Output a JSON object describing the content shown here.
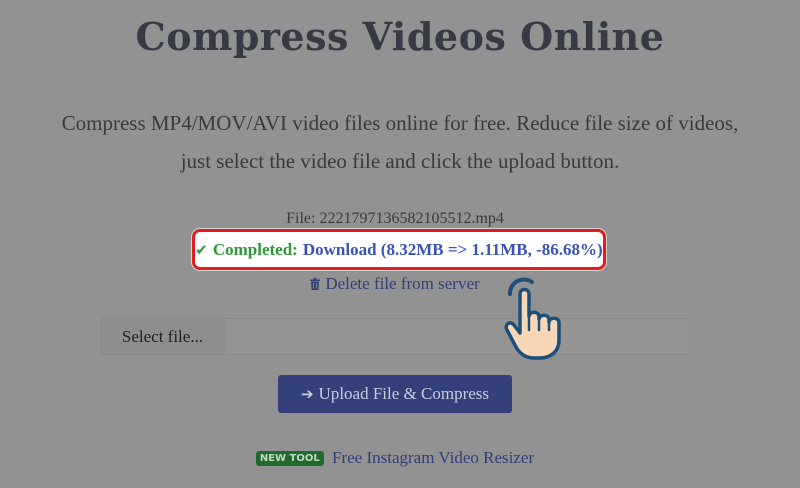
{
  "header": {
    "title": "Compress Videos Online",
    "subtitle_line1": "Compress MP4/MOV/AVI video files online for free. Reduce file size of videos,",
    "subtitle_line2": "just select the video file and click the upload button."
  },
  "result": {
    "file_label": "File: 2221797136582105512.mp4",
    "completed_label": "Completed:",
    "download_label": "Download (8.32MB => 1.11MB, -86.68%)",
    "delete_label": "Delete file from server"
  },
  "form": {
    "select_file_label": "Select file...",
    "upload_button_label": "Upload File & Compress"
  },
  "promo": {
    "badge": "NEW TOOL",
    "link_label": "Free Instagram Video Resizer"
  },
  "icons": {
    "check": "check-icon",
    "trash": "trash-icon",
    "arrow": "arrow-right-icon",
    "hand": "pointing-hand-icon"
  },
  "colors": {
    "overlay_background": "#929292",
    "highlight_border": "#e21d1d",
    "success_green": "#2e9a3a",
    "link_blue": "#3a52b5",
    "button_blue": "#34407a",
    "badge_green": "#1f6b2c"
  }
}
